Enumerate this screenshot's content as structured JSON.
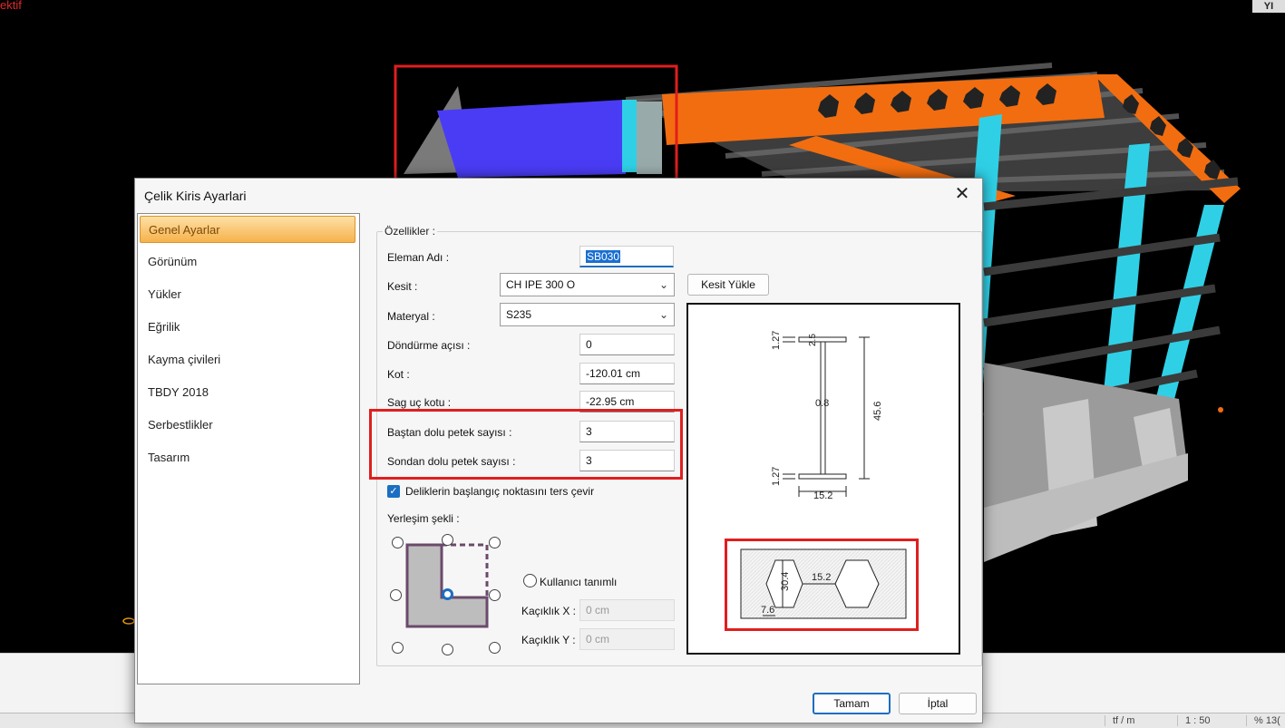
{
  "background": {
    "corner_text": "ektif",
    "logo_text": "YI"
  },
  "statusbar": {
    "units": "tf / m",
    "scale": "1 : 50",
    "zoom": "% 13("
  },
  "dialog": {
    "title": "Çelik Kiris Ayarlari",
    "close_label": "✕",
    "nav": [
      {
        "label": "Genel Ayarlar",
        "active": true
      },
      {
        "label": "Görünüm"
      },
      {
        "label": "Yükler"
      },
      {
        "label": "Eğrilik"
      },
      {
        "label": "Kayma çivileri"
      },
      {
        "label": "TBDY 2018"
      },
      {
        "label": "Serbestlikler"
      },
      {
        "label": "Tasarım"
      }
    ],
    "group_title": "Özellikler :",
    "fields": {
      "eleman_adi": {
        "label": "Eleman Adı :",
        "value": "SB030"
      },
      "kesit": {
        "label": "Kesit :",
        "value": "CH IPE 300 O"
      },
      "materyal": {
        "label": "Materyal :",
        "value": "S235"
      },
      "dondurme": {
        "label": "Döndürme açısı :",
        "value": "0"
      },
      "kot": {
        "label": "Kot :",
        "value": "-120.01 cm"
      },
      "sag_uc_kotu": {
        "label": "Sag uç kotu :",
        "value": "-22.95 cm"
      },
      "bastan": {
        "label": "Baştan dolu petek sayısı :",
        "value": "3"
      },
      "sondan": {
        "label": "Sondan dolu petek sayısı :",
        "value": "3"
      }
    },
    "kesit_yukle_label": "Kesit Yükle",
    "reverse_checkbox_label": "Deliklerin başlangıç noktasını ters çevir",
    "yerlesim_label": "Yerleşim şekli :",
    "kullanici_label": "Kullanıcı tanımlı",
    "kaciklik_x_label": "Kaçıklık X :",
    "kaciklik_x_value": "0 cm",
    "kaciklik_y_label": "Kaçıklık Y :",
    "kaciklik_y_value": "0 cm",
    "section_dims": {
      "flange_top": "1.27",
      "web_radius": "2.5",
      "web_thickness": "0.8",
      "height": "45.6",
      "flange_bottom": "1.27",
      "width": "15.2"
    },
    "hole_dims": {
      "hole_height": "30.4",
      "spacing": "15.2",
      "edge": "7.6"
    },
    "ok_label": "Tamam",
    "cancel_label": "İptal"
  },
  "colors": {
    "accent": "#1b6ec2",
    "highlight_red": "#e01e1e",
    "nav_active": "#f7b24c",
    "beam_orange": "#f26d10",
    "column_cyan": "#2fd0e6",
    "selected_blue": "#4a3cf5"
  }
}
